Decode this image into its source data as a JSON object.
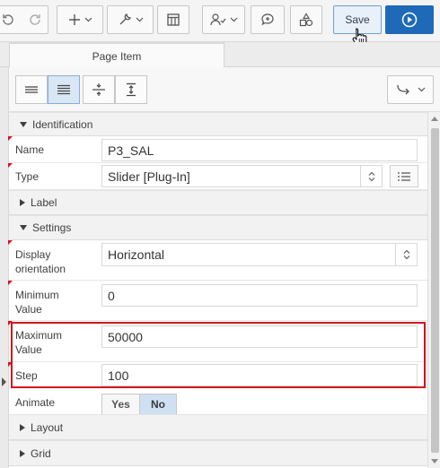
{
  "toolbar": {
    "save_label": "Save",
    "icons": [
      "undo-icon",
      "redo-icon",
      "create-icon",
      "utilities-icon",
      "page-layout-icon",
      "shared-components-icon",
      "comments-icon",
      "shapes-icon",
      "run-icon"
    ]
  },
  "tabs": [
    {
      "label": "Page Item"
    }
  ],
  "sections": {
    "identification": "Identification",
    "label": "Label",
    "settings": "Settings",
    "layout": "Layout",
    "grid": "Grid"
  },
  "fields": {
    "name": {
      "label": "Name",
      "value": "P3_SAL"
    },
    "type": {
      "label": "Type",
      "value": "Slider [Plug-In]"
    },
    "display_orientation": {
      "label": "Display orientation",
      "value": "Horizontal"
    },
    "minimum_value": {
      "label": "Minimum Value",
      "value": "0"
    },
    "maximum_value": {
      "label": "Maximum Value",
      "value": "50000"
    },
    "step": {
      "label": "Step",
      "value": "100"
    },
    "animate": {
      "label": "Animate",
      "yes": "Yes",
      "no": "No",
      "selected": "No"
    }
  },
  "colors": {
    "accent": "#1f6ab8",
    "highlight": "#d4141e",
    "required": "#d8101f"
  }
}
